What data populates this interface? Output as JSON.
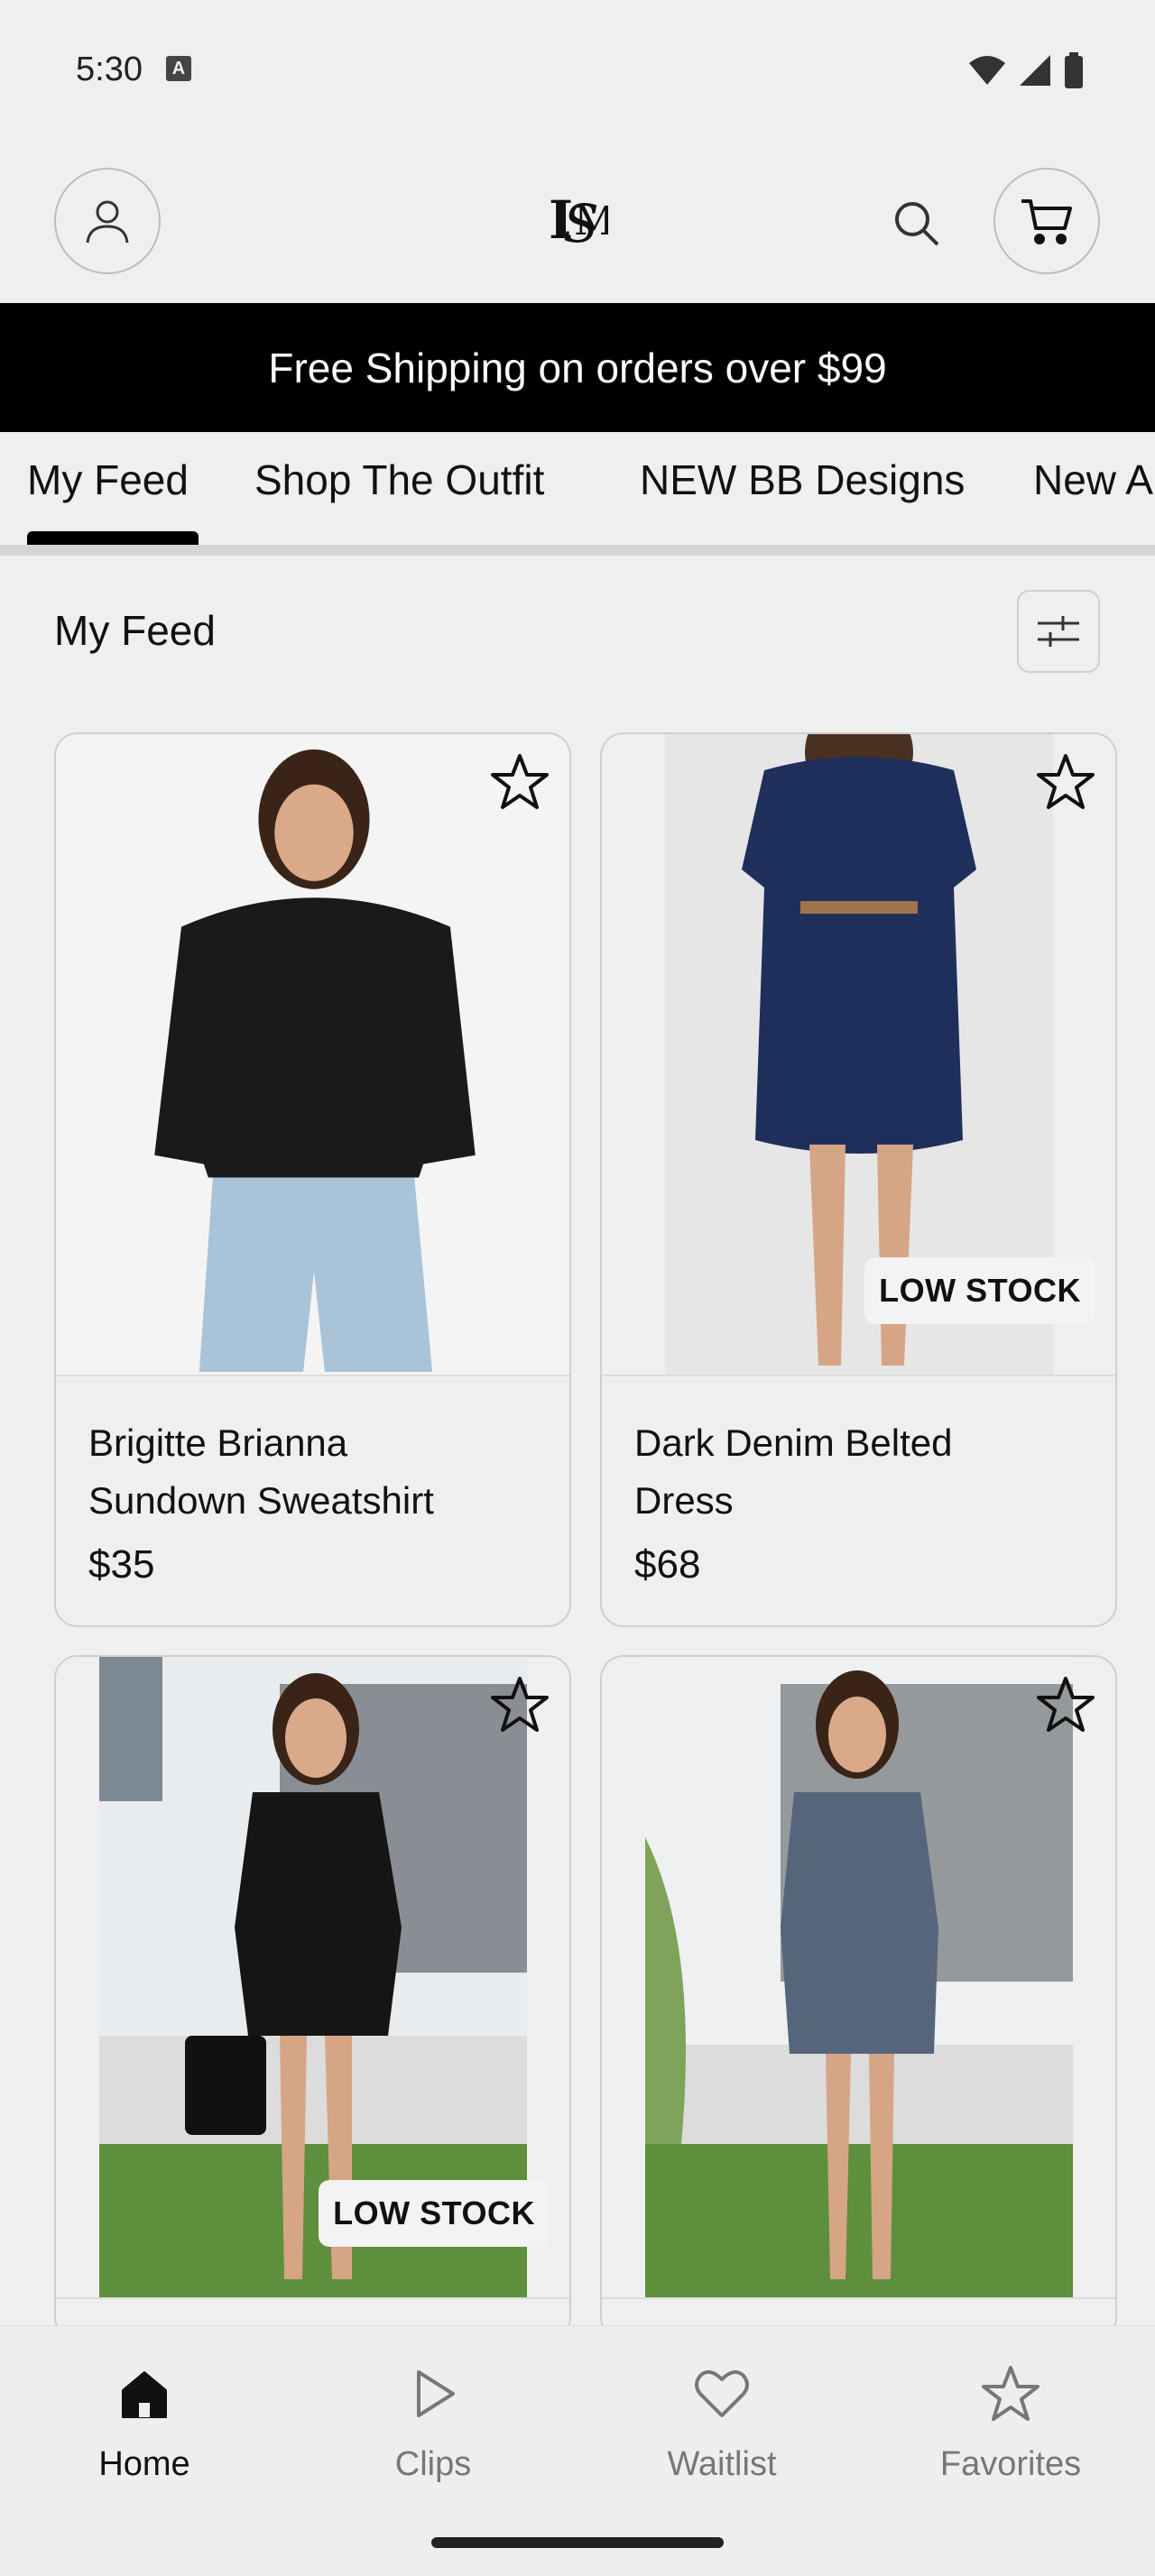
{
  "status_bar": {
    "time": "5:30",
    "notification_badge": "A",
    "icons": [
      "wifi-icon",
      "signal-icon",
      "battery-icon"
    ]
  },
  "header": {
    "logo": "IS monogram logo",
    "icons": [
      "account-icon",
      "search-icon",
      "cart-icon"
    ]
  },
  "promo_banner": {
    "text": "Free Shipping on orders over $99"
  },
  "tabs": [
    {
      "label": "My Feed",
      "active": true
    },
    {
      "label": "Shop The Outfit",
      "active": false
    },
    {
      "label": "NEW BB Designs",
      "active": false
    },
    {
      "label": "New A",
      "active": false
    }
  ],
  "feed": {
    "title": "My Feed",
    "filter_icon": "sliders-icon"
  },
  "products": [
    {
      "name_line1": "Brigitte Brianna",
      "name_line2": "Sundown Sweatshirt",
      "price": "$35",
      "badge": "",
      "photo_color": "#1a1a1a"
    },
    {
      "name_line1": "Dark Denim Belted",
      "name_line2": "Dress",
      "price": "$68",
      "badge": "LOW STOCK",
      "photo_color": "#1f2f5c"
    },
    {
      "name_line1": "",
      "name_line2": "",
      "price": "",
      "badge": "LOW STOCK",
      "photo_color": "#151515"
    },
    {
      "name_line1": "",
      "name_line2": "",
      "price": "",
      "badge": "",
      "photo_color": "#55657c"
    }
  ],
  "bottom_nav": [
    {
      "label": "Home",
      "icon": "home-icon",
      "active": true
    },
    {
      "label": "Clips",
      "icon": "play-icon",
      "active": false
    },
    {
      "label": "Waitlist",
      "icon": "heart-icon",
      "active": false
    },
    {
      "label": "Favorites",
      "icon": "star-icon",
      "active": false
    }
  ],
  "colors": {
    "accent": "#000000",
    "background": "#efefef",
    "inactive": "#777777"
  }
}
